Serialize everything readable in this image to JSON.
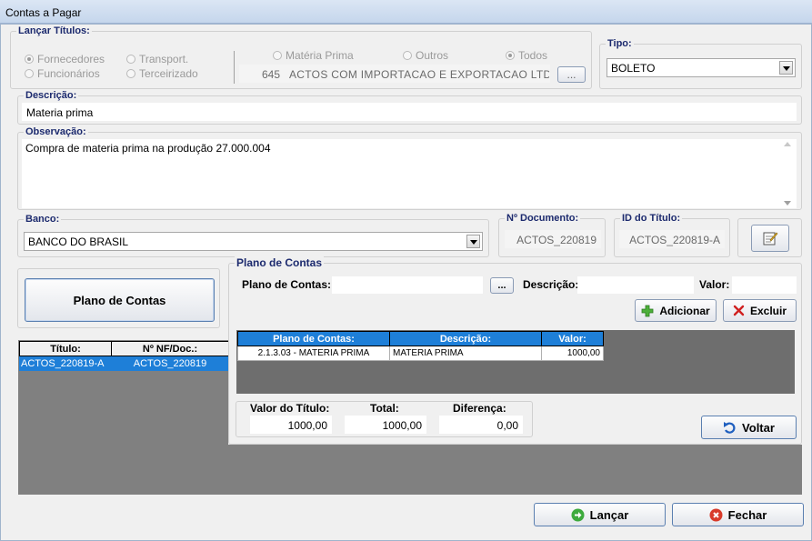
{
  "window": {
    "title": "Contas a Pagar"
  },
  "lancar": {
    "legend": "Lançar Títulos:",
    "radios": {
      "fornecedores": "Fornecedores",
      "funcionarios": "Funcionários",
      "transport": "Transport.",
      "terceirizado": "Terceirizado",
      "materia_prima": "Matéria Prima",
      "outros": "Outros",
      "todos": "Todos"
    },
    "fornecedor_code": "645",
    "fornecedor_name": "ACTOS COM IMPORTACAO E EXPORTACAO LTDA",
    "lookup_btn": "..."
  },
  "tipo": {
    "legend": "Tipo:",
    "value": "BOLETO"
  },
  "descricao": {
    "legend": "Descrição:",
    "value": "Materia prima"
  },
  "observacao": {
    "legend": "Observação:",
    "value": "Compra de materia prima na produção 27.000.004"
  },
  "banco": {
    "legend": "Banco:",
    "value": "BANCO DO BRASIL"
  },
  "documento": {
    "legend": "Nº Documento:",
    "value": "ACTOS_220819"
  },
  "id_titulo": {
    "legend": "ID do Título:",
    "value": "ACTOS_220819-A"
  },
  "plano_btn": "Plano de Contas",
  "titulos_grid": {
    "headers": [
      "Título:",
      "Nº NF/Doc.:"
    ],
    "rows": [
      [
        "ACTOS_220819-A",
        "ACTOS_220819"
      ]
    ]
  },
  "plano": {
    "legend": "Plano de Contas",
    "plano_label": "Plano de Contas:",
    "plano_value": "",
    "lookup_btn": "...",
    "descricao_label": "Descrição:",
    "descricao_value": "",
    "valor_label": "Valor:",
    "valor_value": "",
    "adicionar": "Adicionar",
    "excluir": "Excluir",
    "grid_headers": [
      "Plano de Contas:",
      "Descrição:",
      "Valor:"
    ],
    "grid_rows": [
      [
        "2.1.3.03 - MATERIA PRIMA",
        "MATERIA PRIMA",
        "1000,00"
      ]
    ],
    "valor_titulo_label": "Valor do Título:",
    "valor_titulo": "1000,00",
    "total_label": "Total:",
    "total": "1000,00",
    "diferenca_label": "Diferença:",
    "diferenca": "0,00",
    "voltar": "Voltar"
  },
  "footer": {
    "lancar": "Lançar",
    "fechar": "Fechar"
  },
  "colors": {
    "accent": "#1e7fd8",
    "legend": "#1c2a6e",
    "grid_bg": "#808080"
  }
}
